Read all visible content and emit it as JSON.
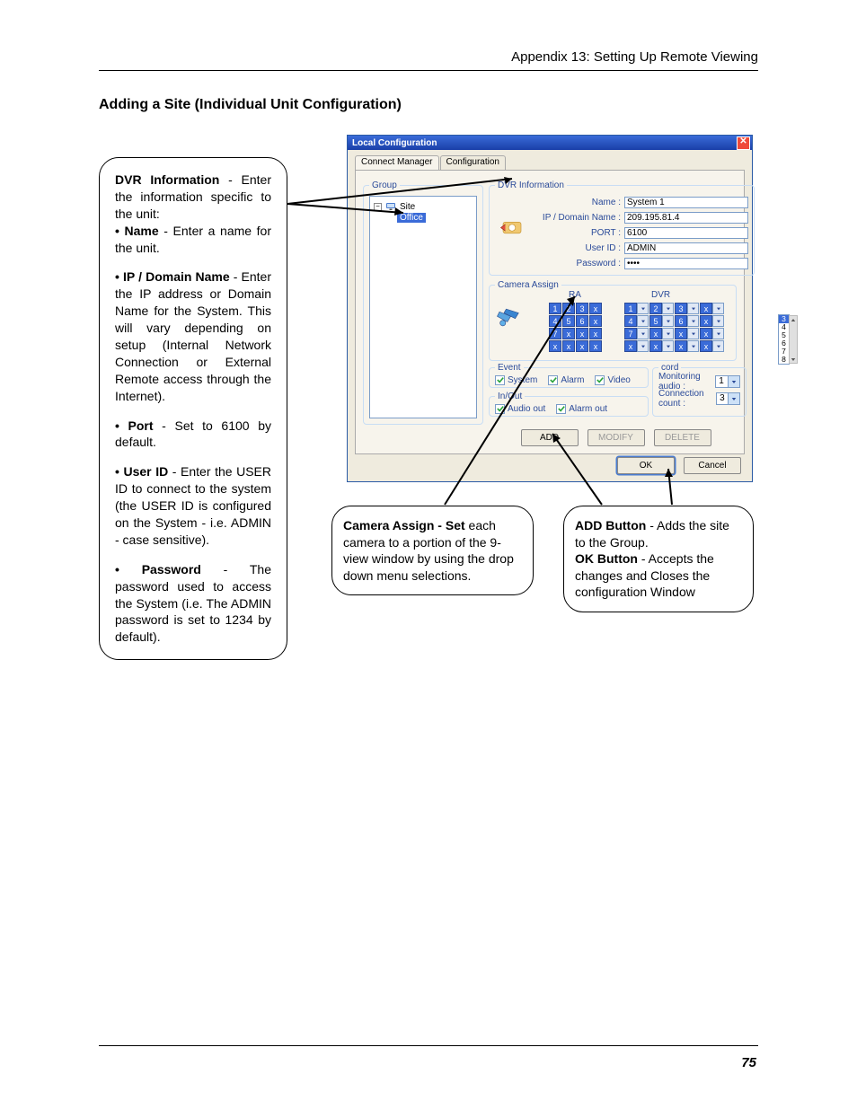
{
  "header": {
    "running_head": "Appendix 13: Setting Up Remote Viewing",
    "page_number": "75"
  },
  "heading": "Adding a Site (Individual Unit Configuration)",
  "left_callout": {
    "dvr_label": "DVR Information",
    "dvr_text": " - Enter the information specific to the unit:",
    "name_label": "• Name",
    "name_text": " - Enter a name for the unit.",
    "ip_label": "• IP / Domain Name",
    "ip_text": " - Enter the IP address or Domain Name for the System. This will vary depending on setup (Internal Network Connection or External Remote access through the Internet).",
    "port_label": "• Port",
    "port_text": " - Set to 6100 by default.",
    "user_label": "• User ID",
    "user_text": " - Enter the USER ID to connect to the system (the USER ID is configured on the System - i.e. ADMIN - case sensitive).",
    "pwd_label": "• Password",
    "pwd_text": " - The password used to access the System (i.e. The ADMIN password is set to 1234 by default)."
  },
  "callout_camera": {
    "title": "Camera Assign - Set",
    "text": " each camera to a portion of the 9-view window by using the drop down menu selections."
  },
  "callout_buttons": {
    "add_label": "ADD Button",
    "add_text": " - Adds the site to the Group.",
    "ok_label": "OK Button",
    "ok_text": " - Accepts the changes and Closes the configuration Window"
  },
  "dialog": {
    "title": "Local Configuration",
    "close": "✕",
    "tabs": {
      "connect": "Connect Manager",
      "config": "Configuration"
    },
    "group": {
      "legend": "Group",
      "root_expand": "−",
      "root_label": "Site",
      "child": "Office"
    },
    "dvr": {
      "legend": "DVR Information",
      "lbl_name": "Name :",
      "val_name": "System 1",
      "lbl_ip": "IP / Domain Name :",
      "val_ip": "209.195.81.4",
      "lbl_port": "PORT :",
      "val_port": "6100",
      "lbl_user": "User ID :",
      "val_user": "ADMIN",
      "lbl_pwd": "Password :",
      "val_pwd": "••••"
    },
    "camera": {
      "legend": "Camera Assign",
      "ra_label": "RA",
      "dvr_label": "DVR",
      "ra_cells": [
        "1",
        "2",
        "3",
        "x",
        "4",
        "5",
        "6",
        "x",
        "7",
        "x",
        "x",
        "x",
        "x",
        "x",
        "x",
        "x"
      ],
      "dvr_cells": [
        "1",
        "2",
        "3",
        "x",
        "4",
        "5",
        "6",
        "x",
        "7",
        "x",
        "x",
        "x",
        "x",
        "x",
        "x",
        "x"
      ],
      "open_list": [
        "3",
        "4",
        "5",
        "6",
        "7",
        "8"
      ]
    },
    "event": {
      "legend": "Event",
      "system": "System",
      "alarm": "Alarm",
      "video": "Video"
    },
    "inout": {
      "legend": "In/Out",
      "audio_out": "Audio out",
      "alarm_out": "Alarm out"
    },
    "cord": {
      "legend": "cord",
      "mon_audio": "Monitoring audio :",
      "mon_val": "1",
      "conn_count": "Connection count :",
      "conn_val": "3"
    },
    "buttons": {
      "add": "ADD",
      "modify": "MODIFY",
      "delete": "DELETE",
      "ok": "OK",
      "cancel": "Cancel"
    }
  }
}
